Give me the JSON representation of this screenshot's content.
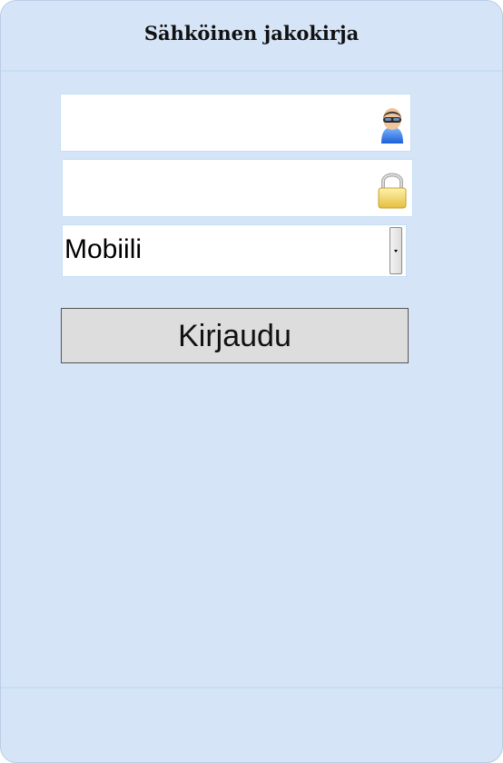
{
  "header": {
    "title": "Sähköinen jakokirja"
  },
  "login_form": {
    "username": {
      "value": "",
      "icon": "user-icon"
    },
    "password": {
      "value": "",
      "icon": "lock-icon"
    },
    "mode_select": {
      "selected": "Mobiili"
    },
    "submit_label": "Kirjaudu"
  },
  "colors": {
    "background": "#d6e4f7",
    "border": "#c5dff4",
    "button": "#dddddd"
  }
}
